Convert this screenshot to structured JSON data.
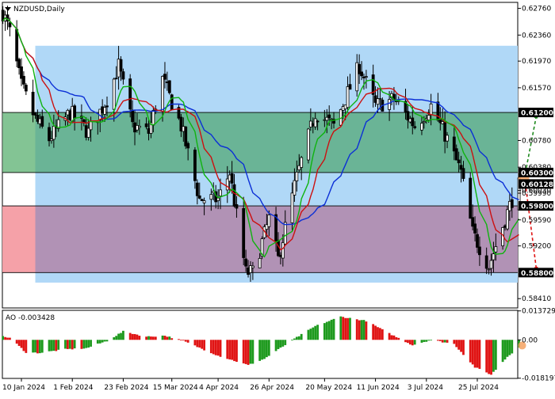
{
  "chart_title": "NZDUSD,Daily",
  "chart_data": {
    "type": "candlestick",
    "symbol": "NZDUSD",
    "timeframe": "Daily",
    "price_ylim": [
      0.5827,
      0.6285
    ],
    "price_ticks": [
      "0.62760",
      "0.62360",
      "0.61970",
      "0.61570",
      "0.61200",
      "0.60780",
      "0.60380",
      "0.60030",
      "0.59990",
      "0.59590",
      "0.59200",
      "0.58800",
      "0.58410"
    ],
    "x_ticks": [
      {
        "label": "10 Jan 2024",
        "date": "2024-01-10"
      },
      {
        "label": "1 Feb 2024",
        "date": "2024-02-01"
      },
      {
        "label": "23 Feb 2024",
        "date": "2024-02-23"
      },
      {
        "label": "15 Mar 2024",
        "date": "2024-03-15"
      },
      {
        "label": "4 Apr 2024",
        "date": "2024-04-04"
      },
      {
        "label": "26 Apr 2024",
        "date": "2024-04-26"
      },
      {
        "label": "20 May 2024",
        "date": "2024-05-20"
      },
      {
        "label": "11 Jun 2024",
        "date": "2024-06-11"
      },
      {
        "label": "3 Jul 2024",
        "date": "2024-07-03"
      },
      {
        "label": "25 Jul 2024",
        "date": "2024-07-25"
      }
    ],
    "price_close_waypoints": [
      {
        "date": "2024-01-02",
        "close": 0.627
      },
      {
        "date": "2024-01-05",
        "close": 0.624
      },
      {
        "date": "2024-01-10",
        "close": 0.616
      },
      {
        "date": "2024-01-16",
        "close": 0.611
      },
      {
        "date": "2024-01-22",
        "close": 0.608
      },
      {
        "date": "2024-01-31",
        "close": 0.612
      },
      {
        "date": "2024-02-08",
        "close": 0.609
      },
      {
        "date": "2024-02-16",
        "close": 0.614
      },
      {
        "date": "2024-02-21",
        "close": 0.619
      },
      {
        "date": "2024-02-27",
        "close": 0.61
      },
      {
        "date": "2024-03-05",
        "close": 0.609
      },
      {
        "date": "2024-03-11",
        "close": 0.617
      },
      {
        "date": "2024-03-19",
        "close": 0.61
      },
      {
        "date": "2024-03-27",
        "close": 0.599
      },
      {
        "date": "2024-04-04",
        "close": 0.599
      },
      {
        "date": "2024-04-09",
        "close": 0.603
      },
      {
        "date": "2024-04-16",
        "close": 0.588
      },
      {
        "date": "2024-04-19",
        "close": 0.588
      },
      {
        "date": "2024-04-26",
        "close": 0.596
      },
      {
        "date": "2024-04-30",
        "close": 0.59
      },
      {
        "date": "2024-05-07",
        "close": 0.601
      },
      {
        "date": "2024-05-16",
        "close": 0.612
      },
      {
        "date": "2024-05-24",
        "close": 0.61
      },
      {
        "date": "2024-06-04",
        "close": 0.619
      },
      {
        "date": "2024-06-11",
        "close": 0.613
      },
      {
        "date": "2024-06-19",
        "close": 0.614
      },
      {
        "date": "2024-06-28",
        "close": 0.61
      },
      {
        "date": "2024-07-05",
        "close": 0.613
      },
      {
        "date": "2024-07-12",
        "close": 0.608
      },
      {
        "date": "2024-07-18",
        "close": 0.603
      },
      {
        "date": "2024-07-23",
        "close": 0.594
      },
      {
        "date": "2024-07-30",
        "close": 0.589
      },
      {
        "date": "2024-08-05",
        "close": 0.595
      },
      {
        "date": "2024-08-09",
        "close": 0.599
      },
      {
        "date": "2024-08-12",
        "close": 0.601
      }
    ],
    "moving_averages": [
      {
        "color": "#0b2fd6"
      },
      {
        "color": "#cc1010"
      },
      {
        "color": "#0fb30f"
      }
    ],
    "levels": [
      {
        "price": 0.612,
        "label": "0.61200",
        "line_color": "#000000",
        "label_bg": "#000000",
        "label_color": "#ffffff"
      },
      {
        "price": 0.603,
        "label": "0.60300",
        "line_color": "#000000",
        "label_bg": "#000000",
        "label_color": "#ffffff"
      },
      {
        "price": 0.60128,
        "label": "0.60128",
        "line_color": "#000000",
        "label_bg": "#000000",
        "label_color": "#ffffff"
      },
      {
        "price": 0.598,
        "label": "0.59800",
        "line_color": "#000000",
        "label_bg": "#000000",
        "label_color": "#ffffff"
      },
      {
        "price": 0.588,
        "label": "0.58800",
        "line_color": "#000000",
        "label_bg": "#000000",
        "label_color": "#ffffff"
      }
    ],
    "zones": [
      {
        "name": "range",
        "color": "#b0d8f7",
        "from_date": "2024-01-16",
        "to_date": "2024-08-15",
        "price_top": 0.622,
        "price_bottom": 0.5865
      },
      {
        "name": "buy",
        "color": "#3f9e5a",
        "opacity": 0.62,
        "from_date": "2024-01-02",
        "to_date": "2024-08-15",
        "price_top": 0.612,
        "price_bottom": 0.603
      },
      {
        "name": "sell",
        "color": "#b2204a",
        "opacity": 0.38,
        "from_date": "2024-01-02",
        "to_date": "2024-08-15",
        "price_top": 0.598,
        "price_bottom": 0.588
      }
    ],
    "forecast_arrows": [
      {
        "direction": "up",
        "color": "#1e8a1e",
        "target": 0.612
      },
      {
        "direction": "down",
        "color": "#e01414",
        "target": 0.588
      }
    ],
    "indicator": {
      "name": "AO",
      "label": "AO -0.003428",
      "value": -0.003428,
      "ylim": [
        -0.0183,
        0.014
      ],
      "ticks": [
        "0.013729",
        "0.00",
        "-0.018197"
      ],
      "up_color": "#1e9a1e",
      "down_color": "#e01414",
      "waypoints": [
        {
          "date": "2024-01-02",
          "v": 0.0015
        },
        {
          "date": "2024-01-05",
          "v": 0.001
        },
        {
          "date": "2024-01-12",
          "v": -0.006
        },
        {
          "date": "2024-01-18",
          "v": -0.0062
        },
        {
          "date": "2024-01-29",
          "v": -0.0045
        },
        {
          "date": "2024-02-07",
          "v": -0.004
        },
        {
          "date": "2024-02-16",
          "v": -0.0005
        },
        {
          "date": "2024-02-23",
          "v": 0.004
        },
        {
          "date": "2024-03-04",
          "v": 0.0015
        },
        {
          "date": "2024-03-12",
          "v": 0.002
        },
        {
          "date": "2024-03-20",
          "v": -0.0005
        },
        {
          "date": "2024-04-04",
          "v": -0.0075
        },
        {
          "date": "2024-04-17",
          "v": -0.012
        },
        {
          "date": "2024-04-24",
          "v": -0.009
        },
        {
          "date": "2024-05-07",
          "v": 0.0005
        },
        {
          "date": "2024-05-16",
          "v": 0.0065
        },
        {
          "date": "2024-05-27",
          "v": 0.011
        },
        {
          "date": "2024-06-07",
          "v": 0.009
        },
        {
          "date": "2024-06-17",
          "v": 0.003
        },
        {
          "date": "2024-06-27",
          "v": -0.0025
        },
        {
          "date": "2024-07-05",
          "v": 0.0
        },
        {
          "date": "2024-07-15",
          "v": -0.002
        },
        {
          "date": "2024-07-24",
          "v": -0.013
        },
        {
          "date": "2024-07-31",
          "v": -0.0165
        },
        {
          "date": "2024-08-07",
          "v": -0.008
        },
        {
          "date": "2024-08-12",
          "v": -0.0034
        }
      ]
    }
  }
}
